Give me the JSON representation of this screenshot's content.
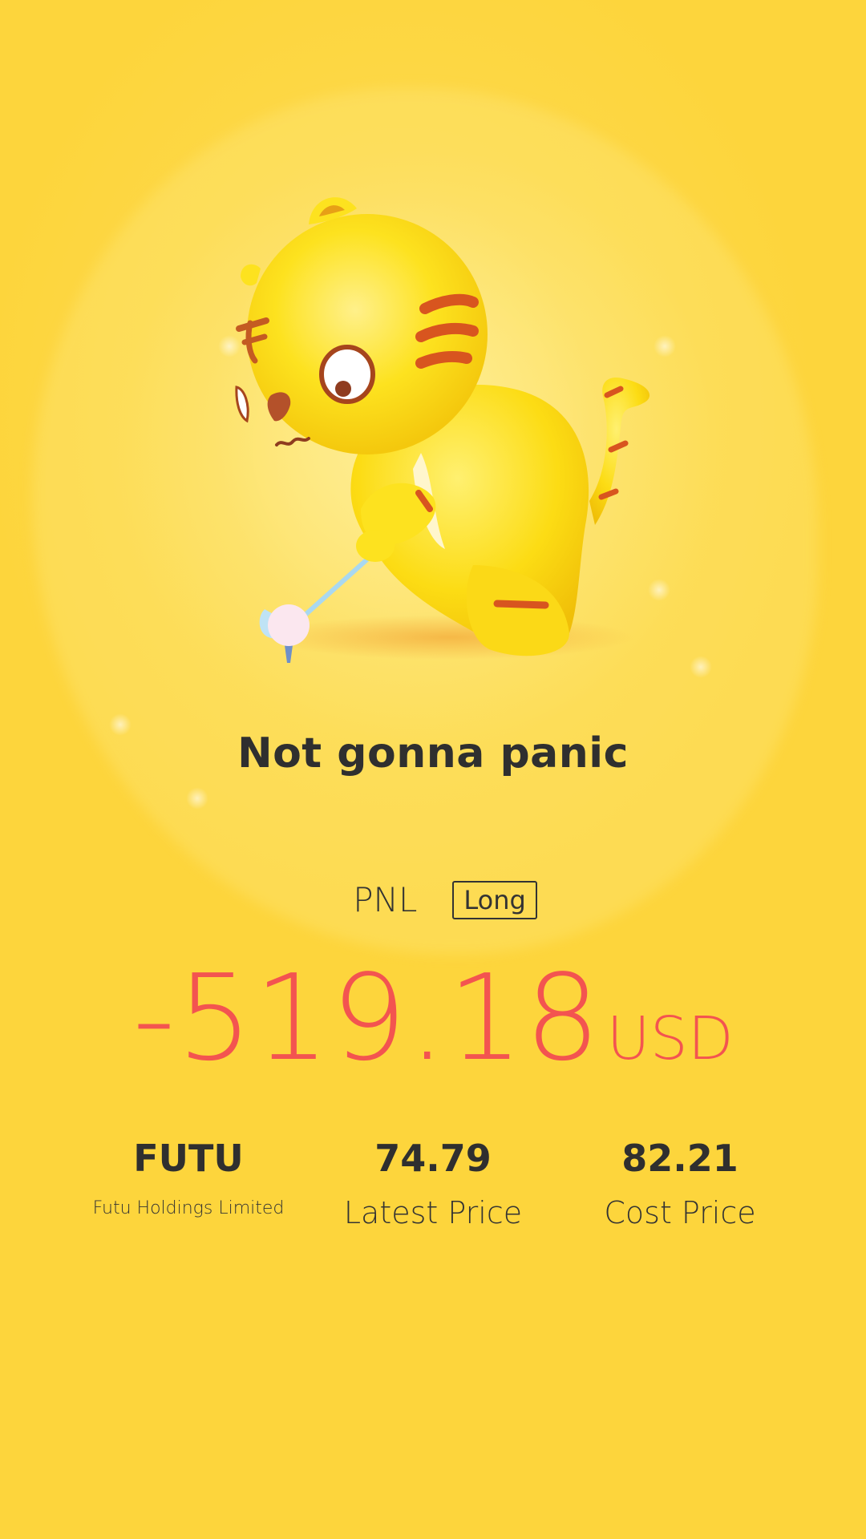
{
  "mood_text": "Not gonna panic",
  "pnl": {
    "label": "PNL",
    "direction": "Long",
    "value": "-519.18",
    "currency": "USD"
  },
  "stats": {
    "symbol": "FUTU",
    "company_name": "Futu Holdings Limited",
    "latest_price": "74.79",
    "latest_price_label": "Latest Price",
    "cost_price": "82.21",
    "cost_price_label": "Cost Price"
  },
  "colors": {
    "background": "#fdd53c",
    "loss_red": "#f35450",
    "text_dark": "#333333",
    "mascot_yellow": "#fde21f",
    "stripe_orange": "#d8551f"
  },
  "icons": {
    "mascot": "tiger-mascot-golfing"
  }
}
